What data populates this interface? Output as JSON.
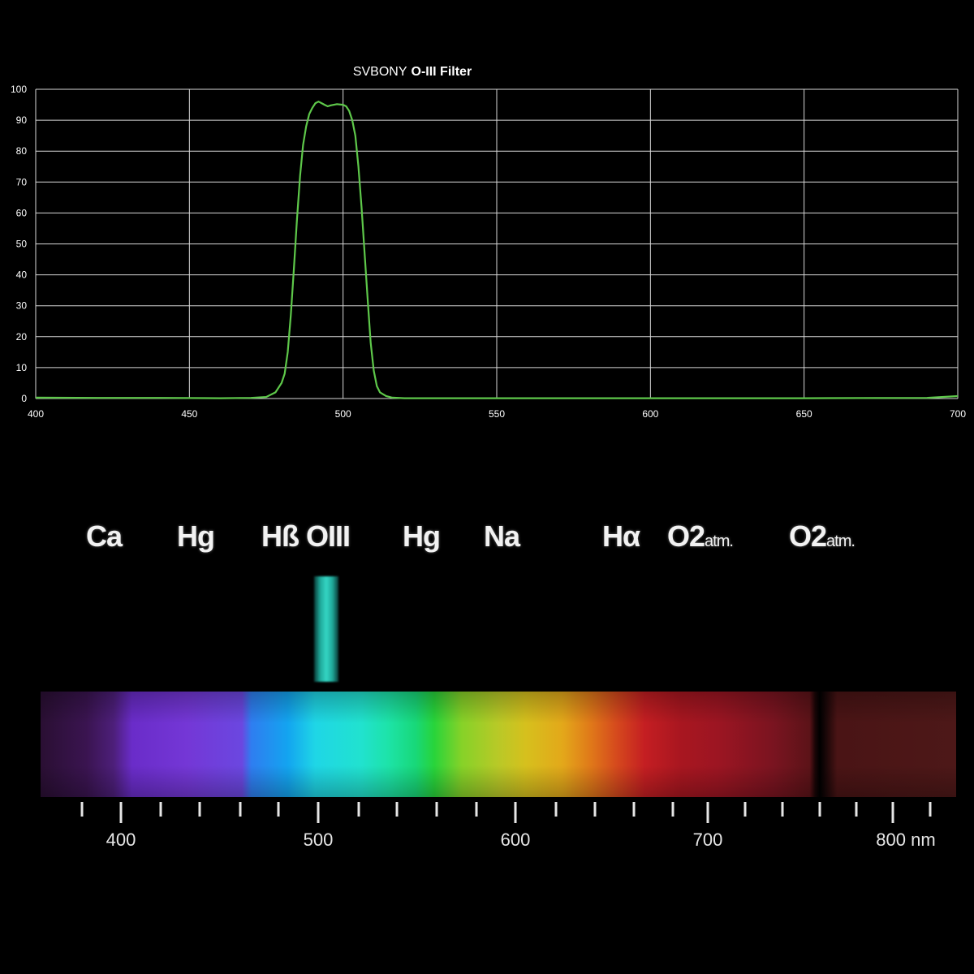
{
  "chart_data": {
    "type": "line",
    "title_part1": "SVBONY",
    "title_part2": "O-III Filter",
    "xlabel": "",
    "ylabel": "",
    "xlim": [
      400,
      700
    ],
    "ylim": [
      0,
      100
    ],
    "xticks": [
      400,
      450,
      500,
      550,
      600,
      650,
      700
    ],
    "yticks": [
      0,
      10,
      20,
      30,
      40,
      50,
      60,
      70,
      80,
      90,
      100
    ],
    "grid": true,
    "line_color": "#5ec84a",
    "series": [
      {
        "x": [
          400,
          420,
          440,
          460,
          470,
          475,
          478,
          480,
          481,
          482,
          483,
          484,
          485,
          486,
          487,
          488,
          489,
          490,
          491,
          492,
          493,
          494,
          495,
          496,
          498,
          500,
          501,
          502,
          503,
          504,
          505,
          506,
          507,
          508,
          509,
          510,
          511,
          512,
          514,
          516,
          520,
          540,
          560,
          600,
          650,
          690,
          700
        ],
        "y": [
          0.3,
          0.2,
          0.2,
          0.1,
          0.2,
          0.5,
          2,
          5,
          8,
          15,
          27,
          42,
          58,
          72,
          82,
          88,
          92,
          94,
          95.5,
          96,
          95.5,
          95,
          94.5,
          94.8,
          95.2,
          95,
          94.5,
          93,
          90,
          85,
          75,
          62,
          47,
          32,
          18,
          9,
          4,
          2,
          0.8,
          0.3,
          0.1,
          0.1,
          0.1,
          0.1,
          0.1,
          0.2,
          0.8
        ]
      }
    ]
  },
  "spectrum": {
    "labels": [
      {
        "main": "Ca",
        "sub": ""
      },
      {
        "main": "Hg",
        "sub": ""
      },
      {
        "main": "Hß OIII",
        "sub": ""
      },
      {
        "main": "Hg",
        "sub": ""
      },
      {
        "main": "Na",
        "sub": ""
      },
      {
        "main": "Hα",
        "sub": ""
      },
      {
        "main": "O2",
        "sub": "atm."
      },
      {
        "main": "O2",
        "sub": "atm."
      }
    ],
    "axis_labels": [
      "400",
      "500",
      "600",
      "700",
      "800 nm"
    ]
  }
}
